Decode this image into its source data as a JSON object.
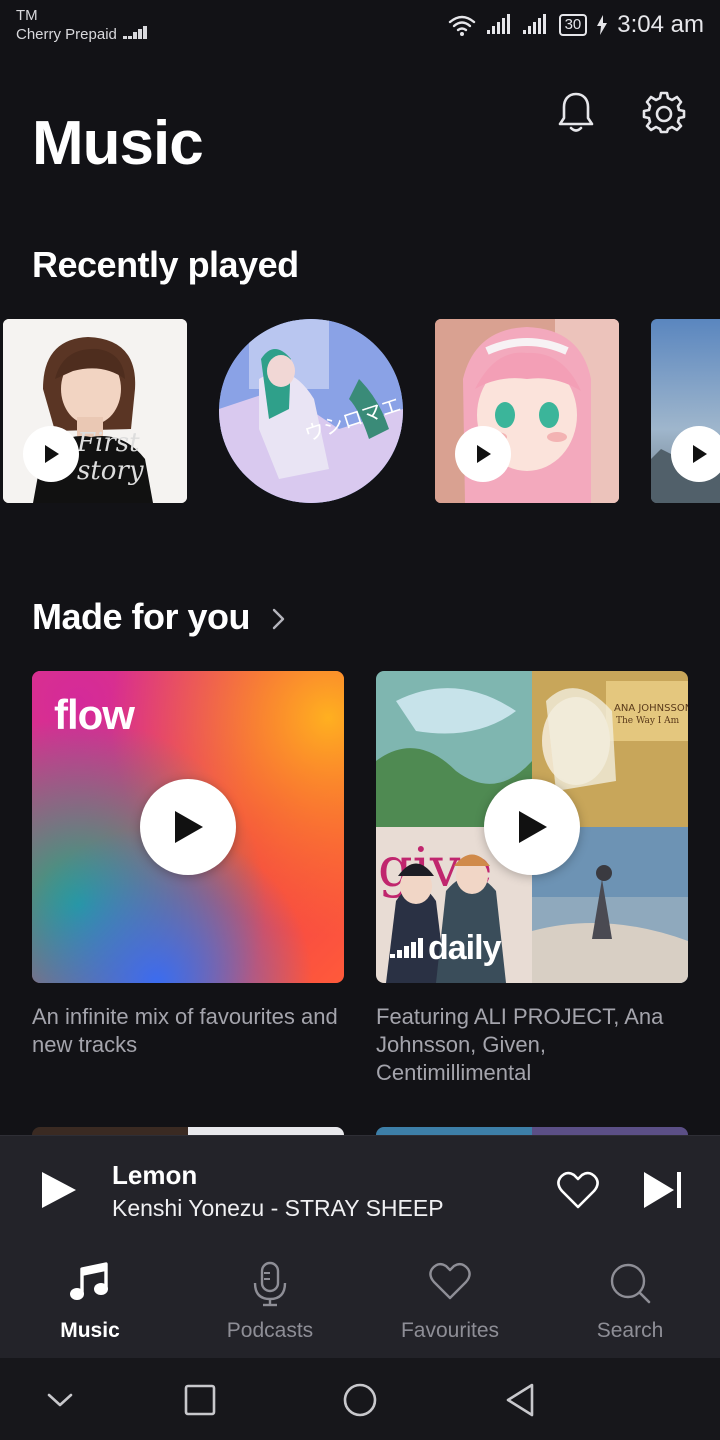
{
  "status_bar": {
    "carrier_line1": "TM",
    "carrier_line2": "Cherry Prepaid",
    "battery": "30",
    "time": "3:04 am"
  },
  "header": {
    "title": "Music",
    "icons": [
      "bell-icon",
      "gear-icon"
    ]
  },
  "recently_played": {
    "title": "Recently played",
    "items": [
      {
        "art_text": "First story"
      },
      {
        "art_text": "ウシロマエ"
      },
      {
        "art_text": ""
      },
      {
        "art_text": ""
      }
    ]
  },
  "made_for_you": {
    "title": "Made for you",
    "cards": [
      {
        "label": "flow",
        "description": "An infinite mix of favourites and new tracks"
      },
      {
        "label": "daily",
        "description": "Featuring ALI PROJECT, Ana Johnsson, Given, Centimillimental"
      }
    ]
  },
  "player": {
    "title": "Lemon",
    "subtitle": "Kenshi Yonezu - STRAY SHEEP"
  },
  "tabs": [
    {
      "label": "Music",
      "icon": "music-note-icon",
      "active": true
    },
    {
      "label": "Podcasts",
      "icon": "microphone-icon",
      "active": false
    },
    {
      "label": "Favourites",
      "icon": "heart-icon",
      "active": false
    },
    {
      "label": "Search",
      "icon": "search-icon",
      "active": false
    }
  ],
  "colors": {
    "background": "#121216",
    "player_bg": "#232329",
    "muted_text": "#a4a4ac"
  }
}
